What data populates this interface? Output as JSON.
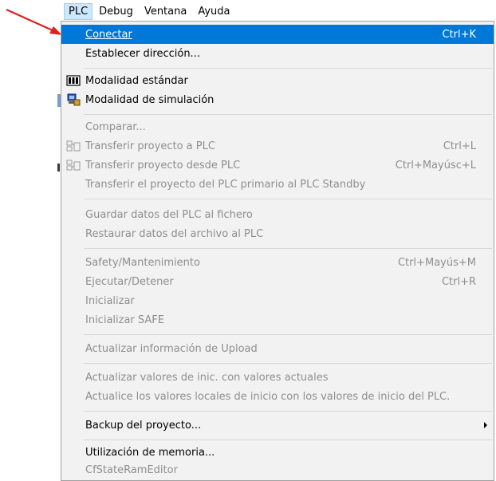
{
  "menubar": {
    "items": [
      "PLC",
      "Debug",
      "Ventana",
      "Ayuda"
    ]
  },
  "menu": {
    "items": [
      {
        "label": "Conectar",
        "shortcut": "Ctrl+K",
        "state": "highlighted"
      },
      {
        "label": "Establecer dirección...",
        "shortcut": "",
        "state": "enabled"
      },
      {
        "label": "Modalidad estándar",
        "shortcut": "",
        "state": "enabled",
        "icon": "standard-mode-icon"
      },
      {
        "label": "Modalidad de simulación",
        "shortcut": "",
        "state": "enabled",
        "icon": "simulation-mode-icon"
      },
      {
        "label": "Comparar...",
        "shortcut": "",
        "state": "disabled"
      },
      {
        "label": "Transferir proyecto a PLC",
        "shortcut": "Ctrl+L",
        "state": "disabled",
        "icon": "transfer-to-plc-icon"
      },
      {
        "label": "Transferir proyecto desde PLC",
        "shortcut": "Ctrl+Mayúsc+L",
        "state": "disabled",
        "icon": "transfer-from-plc-icon"
      },
      {
        "label": "Transferir el proyecto del PLC primario al PLC Standby",
        "shortcut": "",
        "state": "disabled"
      },
      {
        "label": "Guardar datos del PLC al fichero",
        "shortcut": "",
        "state": "disabled"
      },
      {
        "label": "Restaurar datos del archivo al PLC",
        "shortcut": "",
        "state": "disabled"
      },
      {
        "label": "Safety/Mantenimiento",
        "shortcut": "Ctrl+Mayús+M",
        "state": "disabled"
      },
      {
        "label": "Ejecutar/Detener",
        "shortcut": "Ctrl+R",
        "state": "disabled"
      },
      {
        "label": "Inicializar",
        "shortcut": "",
        "state": "disabled"
      },
      {
        "label": "Inicializar SAFE",
        "shortcut": "",
        "state": "disabled"
      },
      {
        "label": "Actualizar información de Upload",
        "shortcut": "",
        "state": "disabled"
      },
      {
        "label": "Actualizar valores de inic. con valores actuales",
        "shortcut": "",
        "state": "disabled"
      },
      {
        "label": "Actualice los valores locales de inicio con los valores de inicio del PLC.",
        "shortcut": "",
        "state": "disabled"
      },
      {
        "label": "Backup del proyecto...",
        "shortcut": "",
        "state": "enabled",
        "submenu": true
      },
      {
        "label": "Utilización de memoria...",
        "shortcut": "",
        "state": "enabled"
      },
      {
        "label": "CfStateRamEditor",
        "shortcut": "",
        "state": "disabled"
      }
    ]
  },
  "colors": {
    "highlight": "#0078d7",
    "disabled_text": "#8e8e8e",
    "arrow": "#e02020"
  }
}
